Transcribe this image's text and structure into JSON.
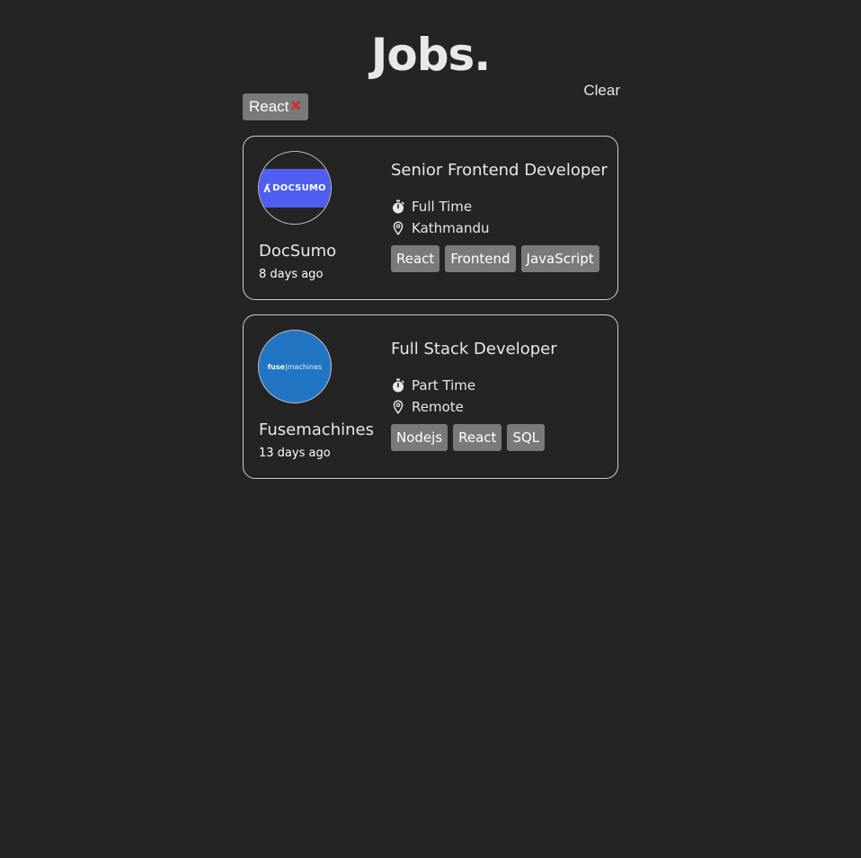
{
  "header": {
    "title": "Jobs.",
    "clear_label": "Clear"
  },
  "filters": [
    {
      "label": "React",
      "remove_icon": "close-icon",
      "remove_glyph": "✕"
    }
  ],
  "jobs": [
    {
      "company": "DocSumo",
      "posted": "8 days ago",
      "title": "Senior Frontend Developer",
      "job_type": "Full Time",
      "location": "Kathmandu",
      "tags": [
        "React",
        "Frontend",
        "JavaScript"
      ],
      "logo": {
        "text": "DOCSUMO",
        "mark": "ʎ",
        "bg": "#4f5ef0"
      }
    },
    {
      "company": "Fusemachines",
      "posted": "13 days ago",
      "title": "Full Stack Developer",
      "job_type": "Part Time",
      "location": "Remote",
      "tags": [
        "Nodejs",
        "React",
        "SQL"
      ],
      "logo": {
        "text_bold": "fuse",
        "text_thin": "machines",
        "bg": "#2275c3"
      }
    }
  ],
  "icons": {
    "job_type": "stopwatch-icon",
    "location": "map-pin-icon"
  },
  "colors": {
    "background": "#242424",
    "tag_bg": "#7a7a7a",
    "remove_red": "#e0211d"
  }
}
